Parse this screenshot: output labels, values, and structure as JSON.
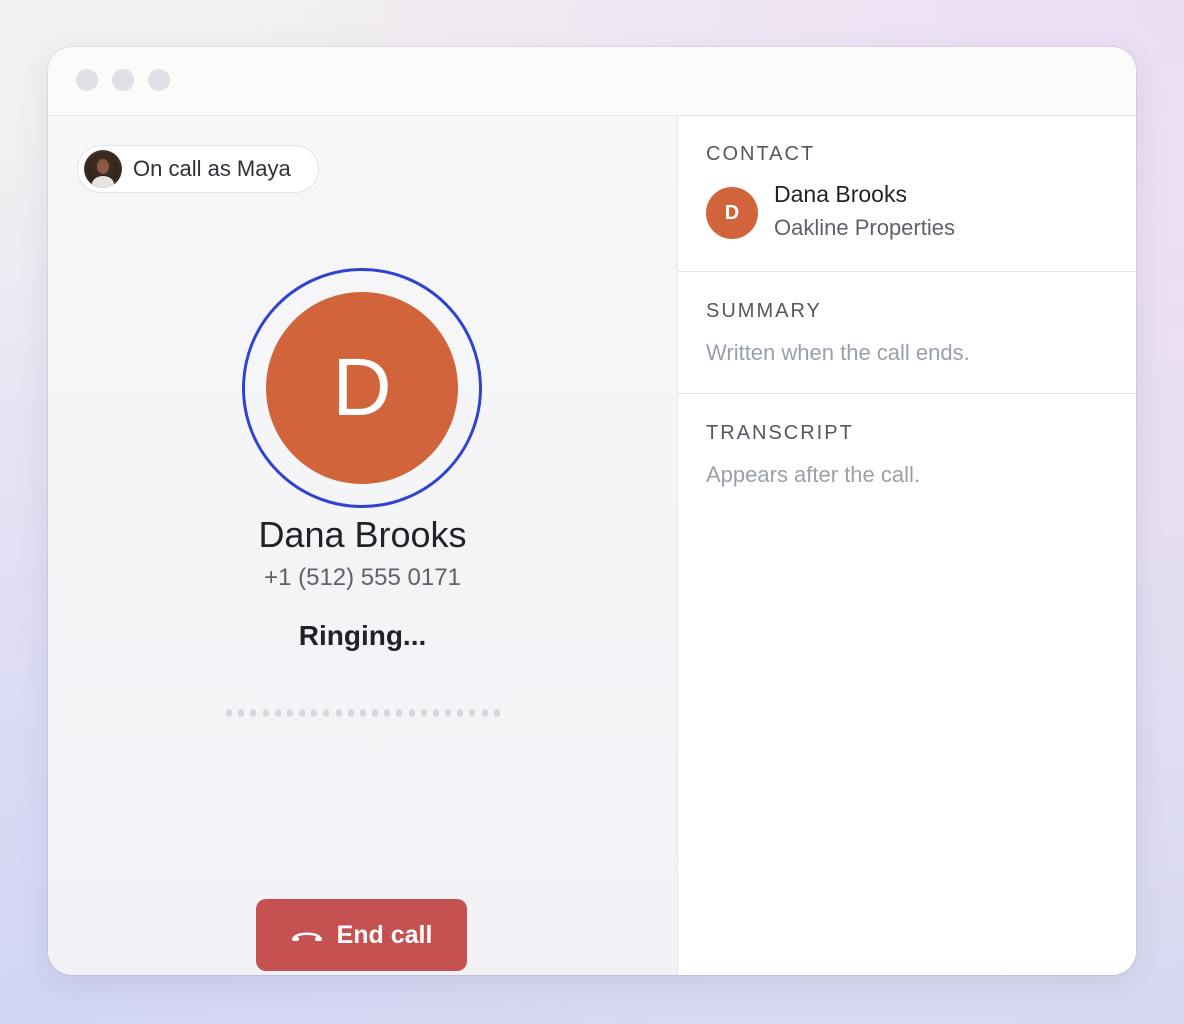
{
  "agent": {
    "label": "On call as Maya"
  },
  "caller": {
    "initial": "D",
    "name": "Dana Brooks",
    "phone": "+1 (512) 555 0171",
    "status": "Ringing..."
  },
  "actions": {
    "end_call_label": "End call"
  },
  "sidebar": {
    "contact": {
      "title": "CONTACT",
      "initial": "D",
      "name": "Dana Brooks",
      "company": "Oakline Properties"
    },
    "summary": {
      "title": "SUMMARY",
      "placeholder": "Written when the call ends."
    },
    "transcript": {
      "title": "TRANSCRIPT",
      "placeholder": "Appears after the call."
    }
  },
  "colors": {
    "avatar": "#d1643a",
    "ring": "#2f43d0",
    "end_call": "#c55151"
  },
  "icons": {
    "end_call": "phone-hangup-icon"
  }
}
